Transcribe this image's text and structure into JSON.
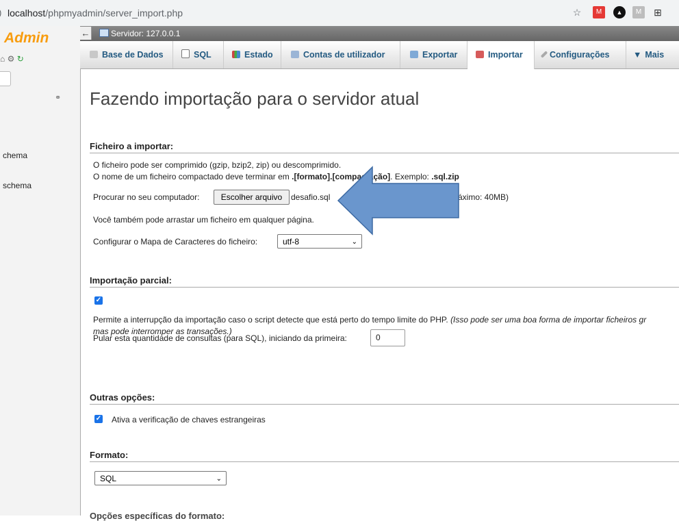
{
  "browser": {
    "url_host": "localhost",
    "url_path": "/phpmyadmin/server_import.php",
    "star_icon": "star-icon",
    "extensions": [
      "red-extension-icon",
      "black-extension-icon",
      "grey-extension-icon",
      "grid-extension-icon"
    ]
  },
  "sidebar": {
    "logo": "Admin",
    "items": [
      {
        "label": "chema"
      },
      {
        "label": "schema"
      }
    ]
  },
  "serverbar": {
    "back": "←",
    "server_label": "Servidor: 127.0.0.1"
  },
  "tabs": [
    {
      "label": "Base de Dados",
      "icon": "database-icon"
    },
    {
      "label": "SQL",
      "icon": "sql-icon"
    },
    {
      "label": "Estado",
      "icon": "status-icon"
    },
    {
      "label": "Contas de utilizador",
      "icon": "users-icon"
    },
    {
      "label": "Exportar",
      "icon": "export-icon"
    },
    {
      "label": "Importar",
      "icon": "import-icon",
      "active": true
    },
    {
      "label": "Configurações",
      "icon": "wrench-icon"
    },
    {
      "label": "Mais",
      "icon": "caret-down-icon"
    }
  ],
  "page": {
    "title": "Fazendo importação para o servidor atual"
  },
  "file_section": {
    "title": "Ficheiro a importar:",
    "line1": "O ficheiro pode ser comprimido (gzip, bzip2, zip) ou descomprimido.",
    "line2_pre": "O nome de um ficheiro compactado deve terminar em ",
    "line2_bold": ".[formato].[compactação]",
    "line2_mid": ". Exemplo: ",
    "line2_example": ".sql.zip",
    "browse_label": "Procurar no seu computador:",
    "choose_button": "Escolher arquivo",
    "chosen_file": "desafio.sql",
    "max_size": "(Máximo: 40MB)",
    "drag_text": "Você também pode arrastar um ficheiro em qualquer página.",
    "charset_label": "Configurar o Mapa de Caracteres do ficheiro:",
    "charset_value": "utf-8"
  },
  "partial_section": {
    "title": "Importação parcial:",
    "allow_interrupt_checked": true,
    "desc": "Permite a interrupção da importação caso o script detecte que está perto do tempo limite do PHP. ",
    "desc_italic_1": "(Isso pode ser uma boa forma de importar ficheiros gr",
    "desc_italic_2": "mas pode interromper as transações.)",
    "skip_label": "Pular esta quantidade de consultas (para SQL), iniciando da primeira:",
    "skip_value": "0"
  },
  "other_section": {
    "title": "Outras opções:",
    "fk_checked": true,
    "fk_label": "Ativa a verificação de chaves estrangeiras"
  },
  "format_section": {
    "title": "Formato:",
    "format_value": "SQL",
    "next_title": "Opções específicas do formato:"
  },
  "colors": {
    "accent_blue": "#235a81",
    "arrow_fill": "#6a96cd",
    "arrow_stroke": "#3d6aa3",
    "checkbox": "#1a73e8"
  }
}
